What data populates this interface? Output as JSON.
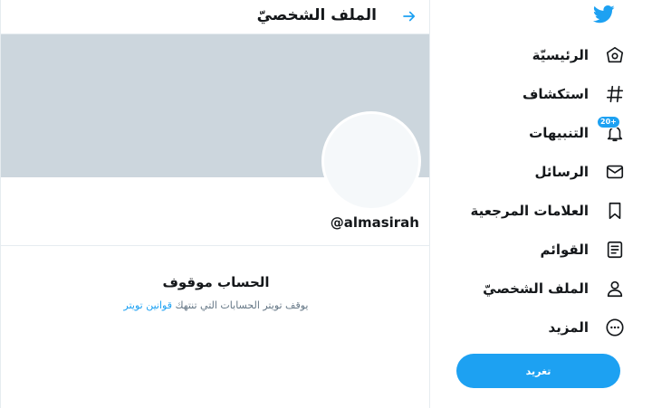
{
  "header": {
    "title": "الملف الشخصيّ"
  },
  "profile": {
    "handle": "@almasirah",
    "suspended_title": "الحساب موقوف",
    "suspended_text": "يوقف تويتر الحسابات التي تنتهك",
    "suspended_link": "قوانين تويتر"
  },
  "sidebar": {
    "items": [
      {
        "label": "الرئيسيّة",
        "icon": "home-icon"
      },
      {
        "label": "استكشاف",
        "icon": "hashtag-icon"
      },
      {
        "label": "التنبيهات",
        "icon": "bell-icon",
        "badge": "20+"
      },
      {
        "label": "الرسائل",
        "icon": "envelope-icon"
      },
      {
        "label": "العلامات المرجعية",
        "icon": "bookmark-icon"
      },
      {
        "label": "القوائم",
        "icon": "list-icon"
      },
      {
        "label": "الملف الشخصيّ",
        "icon": "person-icon"
      },
      {
        "label": "المزيد",
        "icon": "more-icon"
      }
    ],
    "tweet_button": "تغريد"
  },
  "colors": {
    "accent": "#1da1f2",
    "banner": "#ccd6dd",
    "border": "#e6ecf0",
    "muted_text": "#657786"
  }
}
